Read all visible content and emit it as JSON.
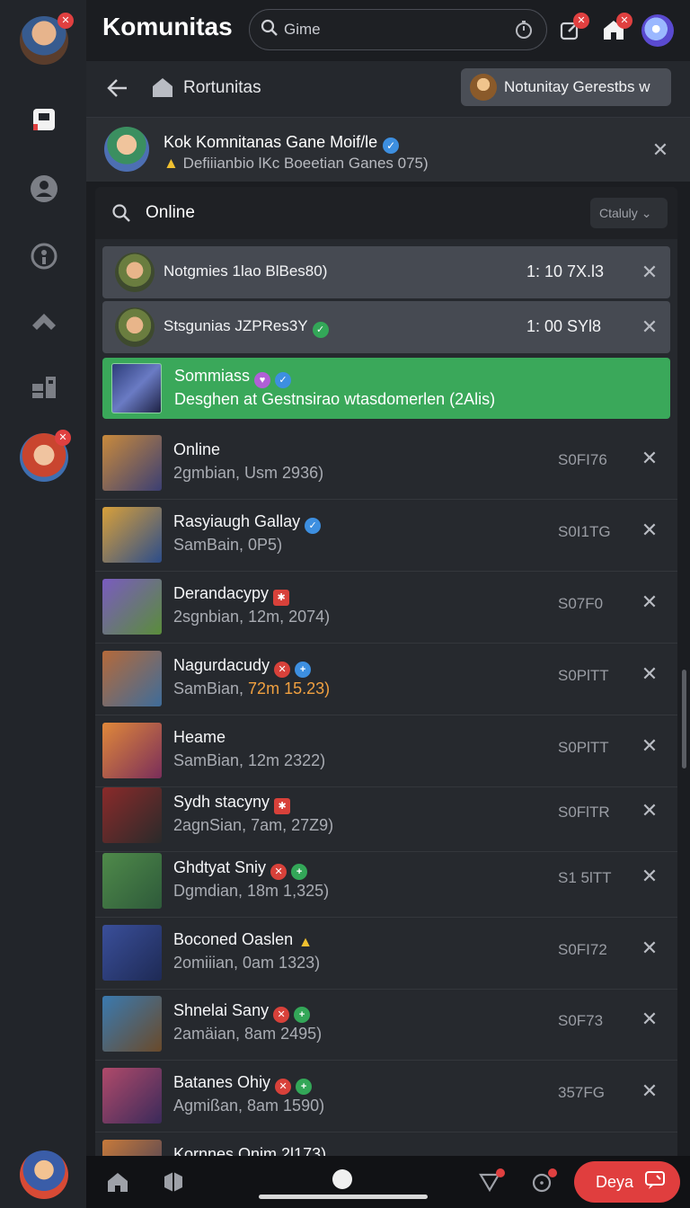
{
  "app": {
    "title": "Komunitas",
    "search_value": "Gime"
  },
  "nav": {
    "title": "Rortunitas",
    "chip_label": "Notunitay Gerestbs w"
  },
  "community": {
    "name": "Kok Komnitanas Gane Moif/le",
    "subtitle": "Defiiianbio lKc Boeetian Ganes 075)"
  },
  "panel": {
    "search_label": "Online",
    "dropdown_label": "Ctaluly"
  },
  "requests": [
    {
      "name": "Notgmies 1lao BlBes80)",
      "time": "1: 10 7X.l3"
    },
    {
      "name": "Stsgunias JZPRes3Y",
      "time": "1: 00 SYl8"
    }
  ],
  "highlight": {
    "name": "Sommiass",
    "subtitle": "Desghen at Gestnsirao wtasdomerlen (2Alis)"
  },
  "rows": [
    {
      "name": "Online",
      "sub": "2gmbian, Usm  2936)",
      "code": "S0FI76",
      "colors": [
        "#c98a3c",
        "#3b3f73"
      ]
    },
    {
      "name": "Rasyiaugh Gallay",
      "sub": "SamBain, 0P5)",
      "code": "S0I1TG",
      "colors": [
        "#d8a03a",
        "#2c4d8a"
      ]
    },
    {
      "name": "Derandacypy",
      "sub": "2sgnbian, 12m, 2074)",
      "code": "S07F0",
      "colors": [
        "#5a8d3a",
        "#7a5bc0"
      ]
    },
    {
      "name": "Nagurdacudy",
      "sub_main": "SamBian, ",
      "sub_hot": "72m 15.23)",
      "code": "S0PlTT",
      "colors": [
        "#b56a3a",
        "#3e6c9a"
      ]
    },
    {
      "name": "Heame",
      "sub": "SamBian, 12m  2322)",
      "code": "S0PlTT",
      "colors": [
        "#e0883a",
        "#7a2e5a"
      ]
    },
    {
      "name": "Sydh stacyny",
      "sub": "2agnSian, 7am, 27Z9)",
      "code": "S0FlTR",
      "colors": [
        "#8a2a2a",
        "#2a2a2a"
      ]
    },
    {
      "name": "Ghdtyat Sniy",
      "sub": "Dgmdian, 18m 1,325)",
      "code": "S1 5lTT",
      "colors": [
        "#4f8a4a",
        "#2e5a3a"
      ]
    },
    {
      "name": "Boconed Oaslen",
      "sub": "2omiiian, 0am  1323)",
      "code": "S0FI72",
      "colors": [
        "#3a4f9a",
        "#1e2a55"
      ]
    },
    {
      "name": "Shnelai Sany",
      "sub": "2amäian, 8am  2495)",
      "code": "S0F73",
      "colors": [
        "#3a7ab0",
        "#6a4a2a"
      ]
    },
    {
      "name": "Batanes Ohiy",
      "sub": "Agmißan, 8am  1590)",
      "code": "357FG",
      "colors": [
        "#b04a6a",
        "#3a2a5a"
      ]
    },
    {
      "name": "Kornnes Onim 2l173)",
      "sub": "",
      "code": "",
      "colors": [
        "#c87a3a",
        "#3a3a5a"
      ]
    }
  ],
  "bottom": {
    "cta_label": "Deya"
  },
  "colors": {
    "accent_green": "#3aa85a",
    "accent_red": "#e03e3e",
    "verified_blue": "#3d8fe0"
  }
}
